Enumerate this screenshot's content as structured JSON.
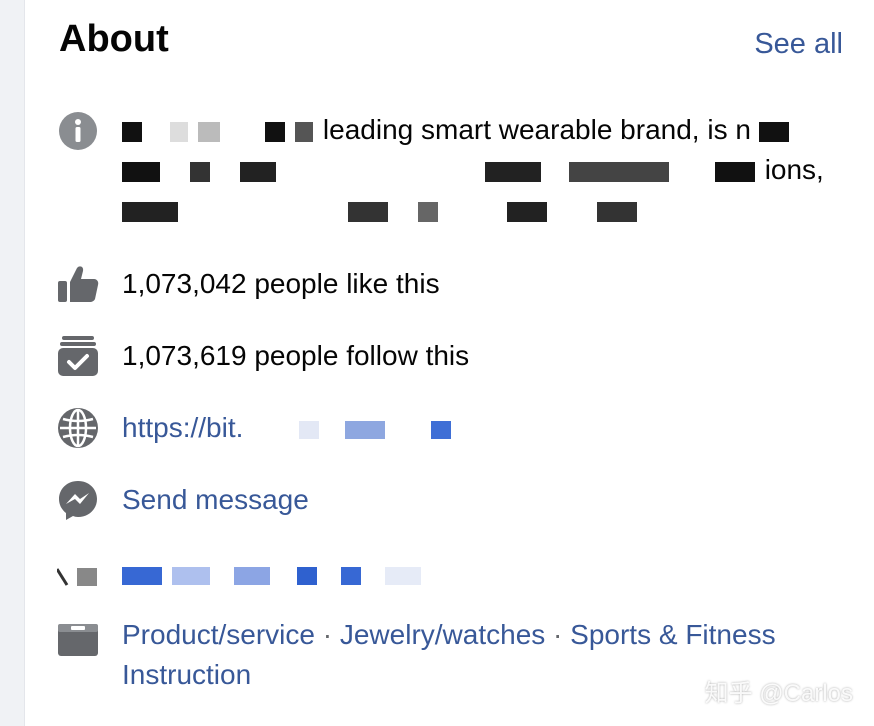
{
  "header": {
    "title": "About",
    "see_all_label": "See all"
  },
  "description": {
    "line1": "leading smart wearable brand, is n",
    "line2": "ions,",
    "line3": ""
  },
  "likes": {
    "text": "1,073,042 people like this"
  },
  "follows": {
    "text": "1,073,619 people follow this"
  },
  "website": {
    "text": "https://bit."
  },
  "message": {
    "label": "Send message"
  },
  "categories": {
    "items": [
      "Product/service",
      "Jewelry/watches",
      "Sports & Fitness Instruction"
    ],
    "separator": " · "
  },
  "watermark": {
    "text": "知乎 @Carlos"
  },
  "colors": {
    "link": "#385898",
    "icon": "#65676b",
    "text": "#050505"
  }
}
